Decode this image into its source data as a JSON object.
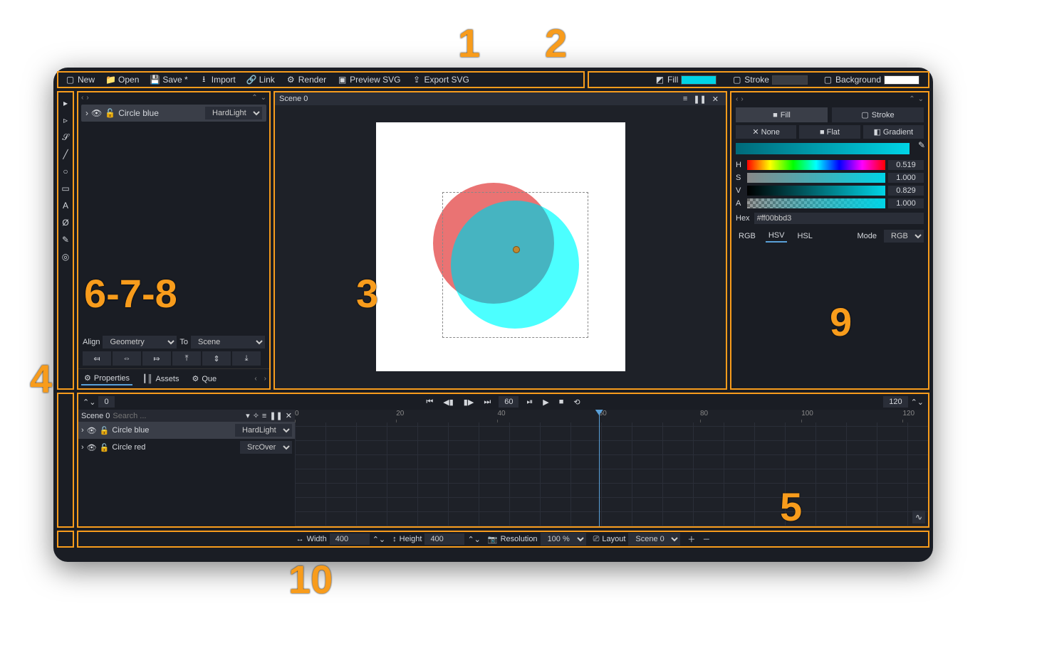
{
  "menubar": {
    "new": "New",
    "open": "Open",
    "save": "Save *",
    "import": "Import",
    "link": "Link",
    "render": "Render",
    "preview_svg": "Preview SVG",
    "export_svg": "Export SVG"
  },
  "menubar_right": {
    "fill": "Fill",
    "stroke": "Stroke",
    "background": "Background"
  },
  "viewport": {
    "scene": "Scene 0"
  },
  "layers_panel": {
    "layer": {
      "name": "Circle blue",
      "blend": "HardLight"
    },
    "align_label": "Align",
    "align_value": "Geometry",
    "to_label": "To",
    "to_value": "Scene",
    "tabs": {
      "properties": "Properties",
      "assets": "Assets",
      "queue": "Que"
    }
  },
  "color_panel": {
    "fill": "Fill",
    "stroke": "Stroke",
    "none": "None",
    "flat": "Flat",
    "gradient": "Gradient",
    "h": "H",
    "s": "S",
    "v": "V",
    "a": "A",
    "h_val": "0.519",
    "s_val": "1.000",
    "v_val": "0.829",
    "a_val": "1.000",
    "hex_label": "Hex",
    "hex_value": "#ff00bbd3",
    "rgb": "RGB",
    "hsv": "HSV",
    "hsl": "HSL",
    "mode_label": "Mode",
    "mode_value": "RGB"
  },
  "timeline": {
    "frame_start": "0",
    "frame_current": "60",
    "frame_end": "120",
    "scene": "Scene 0",
    "search_placeholder": "Search ...",
    "layers": [
      {
        "name": "Circle blue",
        "blend": "HardLight"
      },
      {
        "name": "Circle red",
        "blend": "SrcOver"
      }
    ],
    "ticks": [
      "0",
      "20",
      "40",
      "60",
      "80",
      "100",
      "120"
    ]
  },
  "bottombar": {
    "width_label": "Width",
    "width_value": "400",
    "height_label": "Height",
    "height_value": "400",
    "resolution_label": "Resolution",
    "resolution_value": "100 %",
    "layout_label": "Layout",
    "layout_value": "Scene 0"
  },
  "annotations": {
    "n1": "1",
    "n2": "2",
    "n3": "3",
    "n4": "4",
    "n5": "5",
    "n678": "6-7-8",
    "n9": "9",
    "n10": "10"
  }
}
